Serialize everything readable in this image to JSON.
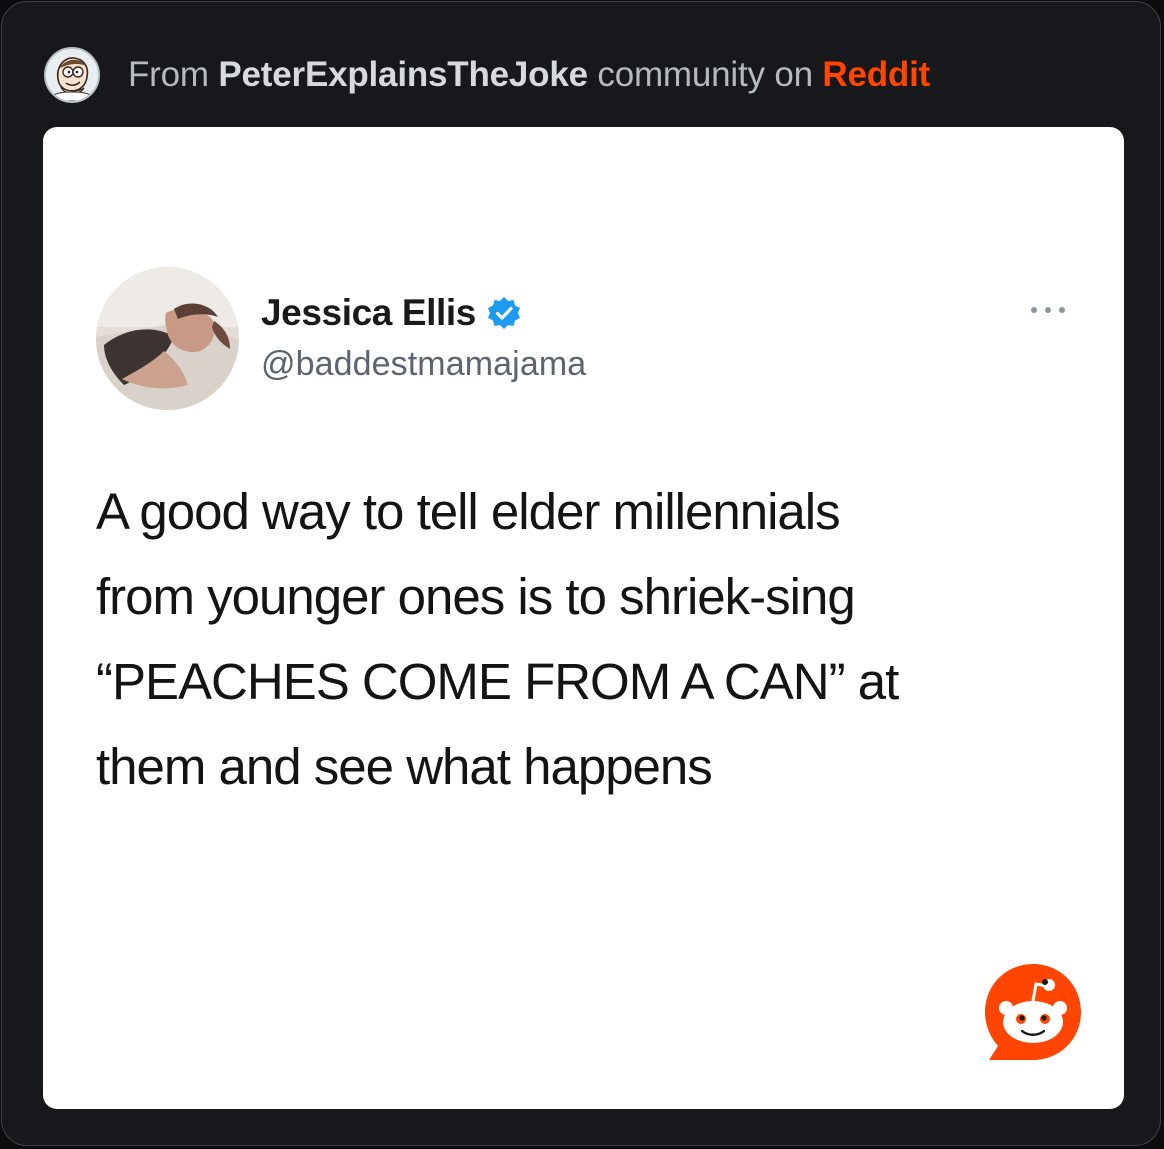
{
  "header": {
    "prefix": "From ",
    "community": "PeterExplainsTheJoke",
    "middle": " community on ",
    "platform": "Reddit",
    "avatar_icon": "peter-griffin-avatar-icon"
  },
  "tweet": {
    "display_name": "Jessica Ellis",
    "handle": "@baddestmamajama",
    "verified_icon": "verified-badge-icon",
    "more_icon": "more-options-icon",
    "lines": [
      "A good way to tell elder millennials",
      "from younger ones is to shriek-sing",
      "“PEACHES COME FROM A CAN” at",
      "them and see what happens"
    ]
  },
  "watermark": {
    "icon": "reddit-snoo-icon"
  },
  "colors": {
    "background": "#16181c",
    "card": "#ffffff",
    "reddit_orange": "#ff4500",
    "verified_blue": "#1d9bf0",
    "header_text": "#b5bac1"
  }
}
